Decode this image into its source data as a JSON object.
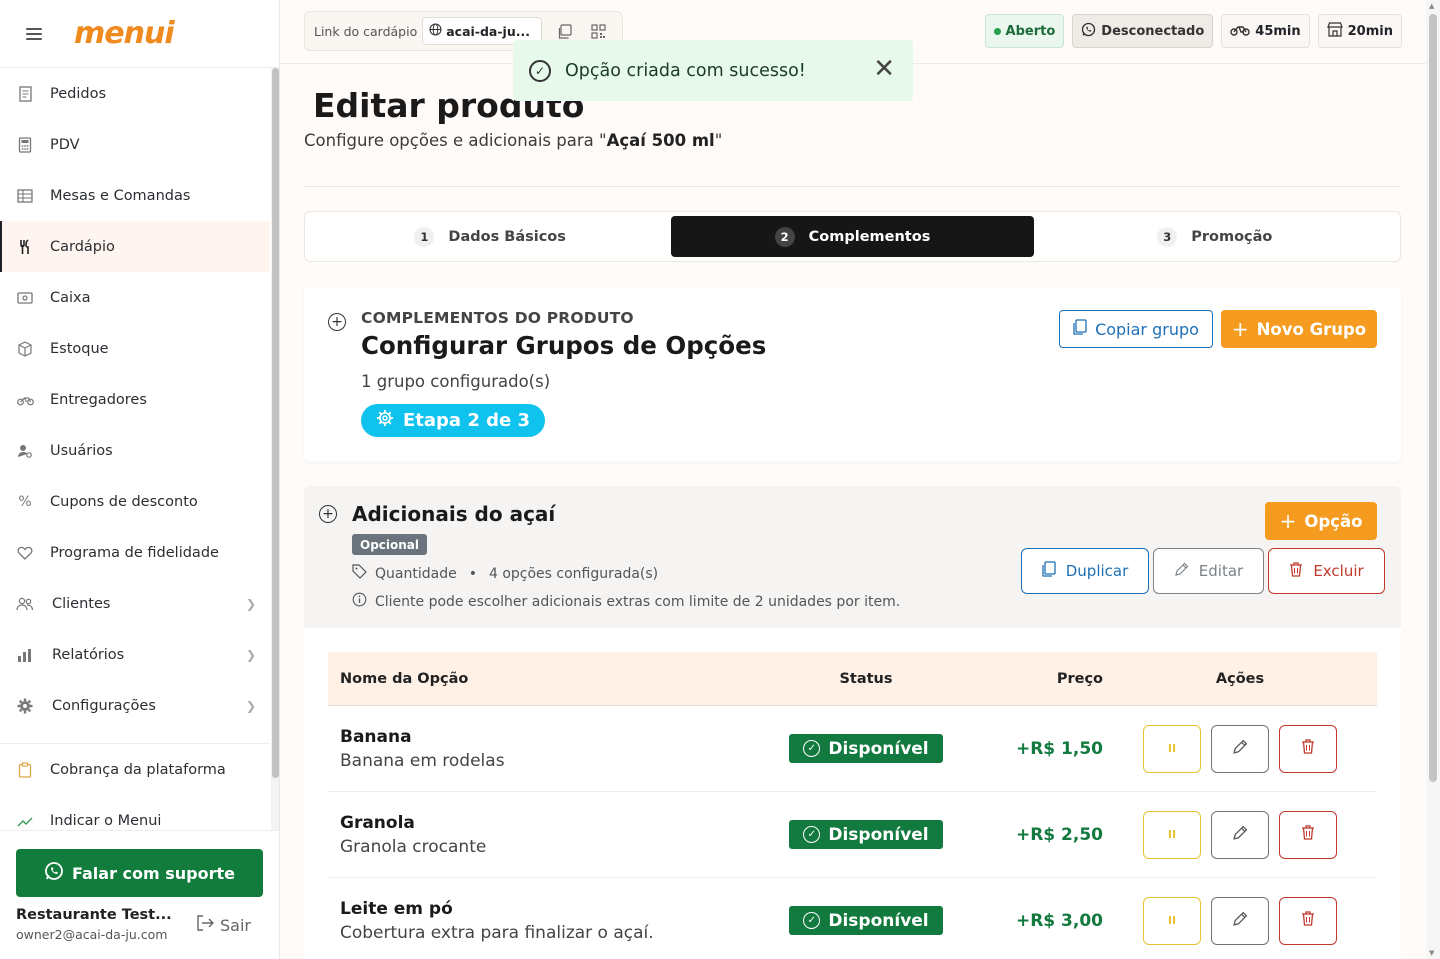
{
  "app": {
    "logo": "menui"
  },
  "sidebar": {
    "items": [
      {
        "label": "Pedidos",
        "icon": "receipt-icon",
        "active": false
      },
      {
        "label": "PDV",
        "icon": "calculator-icon",
        "active": false
      },
      {
        "label": "Mesas e Comandas",
        "icon": "table-grid-icon",
        "active": false
      },
      {
        "label": "Cardápio",
        "icon": "utensils-icon",
        "active": true
      },
      {
        "label": "Caixa",
        "icon": "cash-icon",
        "active": false
      },
      {
        "label": "Estoque",
        "icon": "box-icon",
        "active": false
      },
      {
        "label": "Entregadores",
        "icon": "bike-icon",
        "active": false
      },
      {
        "label": "Usuários",
        "icon": "user-gear-icon",
        "active": false
      },
      {
        "label": "Cupons de desconto",
        "icon": "percent-icon",
        "active": false
      },
      {
        "label": "Programa de fidelidade",
        "icon": "heart-icon",
        "active": false
      },
      {
        "label": "Clientes",
        "icon": "users-icon",
        "active": false
      },
      {
        "label": "Relatórios",
        "icon": "bar-chart-icon",
        "active": false
      },
      {
        "label": "Configurações",
        "icon": "gear-icon",
        "active": false
      },
      {
        "label": "Cobrança da plataforma",
        "icon": "clipboard-icon",
        "active": false
      },
      {
        "label": "Indicar o Menui",
        "icon": "share-icon",
        "active": false
      }
    ],
    "support_label": "Falar com suporte",
    "user_name": "Restaurante Test...",
    "user_email": "owner2@acai-da-ju.com",
    "logout_label": "Sair"
  },
  "topbar": {
    "link_label": "Link do cardápio",
    "link_slug": "acai-da-ju...",
    "status_open": "Aberto",
    "whatsapp_status": "Desconectado",
    "delivery_time": "45min",
    "pickup_time": "20min"
  },
  "toast": {
    "message": "Opção criada com sucesso!"
  },
  "page": {
    "title": "Editar produto",
    "subtitle_prefix": "Configure opções e adicionais para \"",
    "product_name": "Açaí 500 ml",
    "subtitle_suffix": "\""
  },
  "stepper": [
    {
      "num": "1",
      "label": "Dados Básicos",
      "active": false
    },
    {
      "num": "2",
      "label": "Complementos",
      "active": true
    },
    {
      "num": "3",
      "label": "Promoção",
      "active": false
    }
  ],
  "complements": {
    "kicker": "COMPLEMENTOS DO PRODUTO",
    "title": "Configurar Grupos de Opções",
    "count": "1 grupo configurado(s)",
    "stage": "Etapa 2 de 3",
    "copy_group": "Copiar grupo",
    "new_group": "Novo Grupo"
  },
  "group": {
    "title": "Adicionais do açaí",
    "badge": "Opcional",
    "type": "Quantidade",
    "options_count": "4 opções configurada(s)",
    "info": "Cliente pode escolher adicionais extras com limite de 2 unidades por item.",
    "add_option": "Opção",
    "duplicate": "Duplicar",
    "edit": "Editar",
    "delete": "Excluir"
  },
  "table": {
    "headers": {
      "name": "Nome da Opção",
      "status": "Status",
      "price": "Preço",
      "actions": "Ações"
    },
    "rows": [
      {
        "name": "Banana",
        "desc": "Banana em rodelas",
        "status": "Disponível",
        "price": "+R$ 1,50"
      },
      {
        "name": "Granola",
        "desc": "Granola crocante",
        "status": "Disponível",
        "price": "+R$ 2,50"
      },
      {
        "name": "Leite em pó",
        "desc": "Cobertura extra para finalizar o açaí.",
        "status": "Disponível",
        "price": "+R$ 3,00"
      }
    ],
    "pause_glyph": "II"
  },
  "colors": {
    "brand": "#ef8a1f",
    "success": "#137a3f",
    "accent_blue": "#1f6fb5",
    "cyan": "#10c2ee",
    "orange": "#f59b1f",
    "danger": "#c0392b"
  }
}
